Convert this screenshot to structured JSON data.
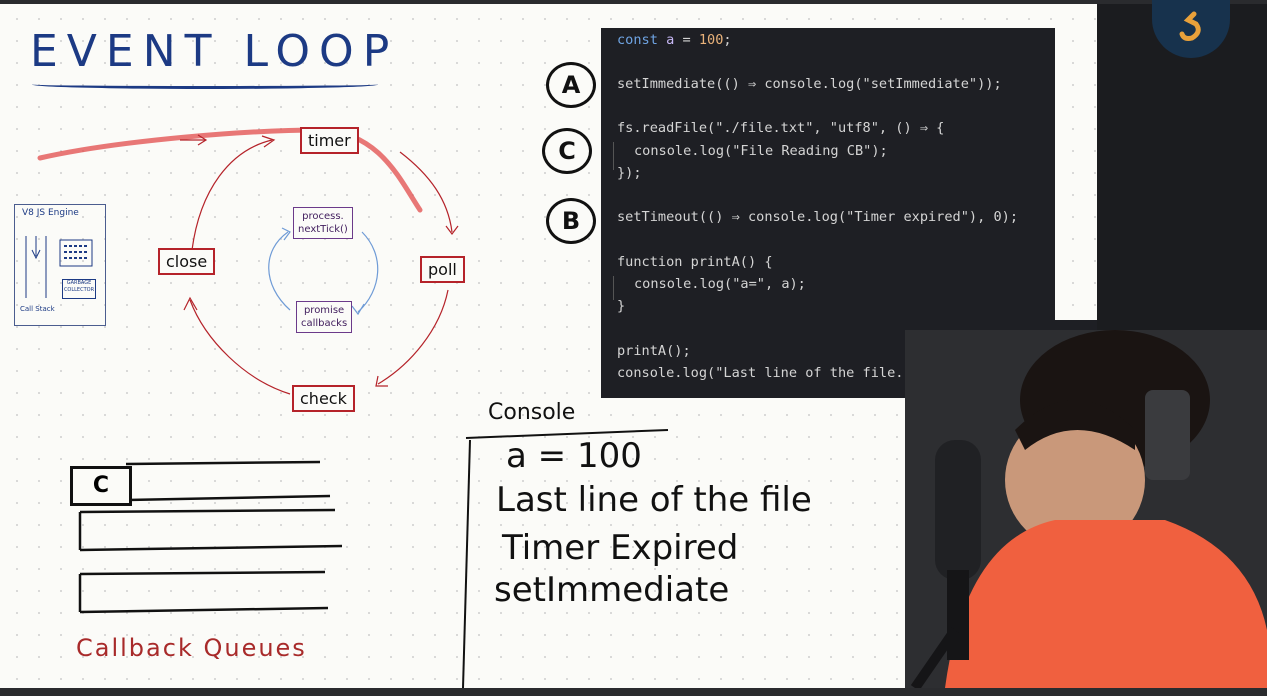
{
  "board": {
    "title": "EVENT LOOP",
    "phases": {
      "timer": "timer",
      "poll": "poll",
      "check": "check",
      "close": "close"
    },
    "microtasks": {
      "next_tick": "process.\nnextTick()",
      "promise": "promise\ncallbacks"
    },
    "v8": {
      "title": "V8 JS Engine",
      "call_stack": "Call Stack",
      "gc": "GARBAGE\nCOLLECTOR"
    },
    "queues": {
      "first_item": "C",
      "label": "Callback Queues"
    },
    "console": {
      "label": "Console",
      "lines": [
        "a = 100",
        "Last line of the file",
        "Timer Expired",
        "setImmediate"
      ]
    },
    "badges": {
      "a": "A",
      "c": "C",
      "b": "B"
    }
  },
  "code": {
    "line1": "const a = 100;",
    "line2": "setImmediate(() ⇒ console.log(\"setImmediate\"));",
    "line3": "fs.readFile(\"./file.txt\", \"utf8\", () ⇒ {",
    "line4": "console.log(\"File Reading CB\");",
    "line5": "});",
    "line6": "setTimeout(() ⇒ console.log(\"Timer expired\"), 0);",
    "line7": "function printA() {",
    "line8": "console.log(\"a=\", a);",
    "line9": "}",
    "line10": "printA();",
    "line11": "console.log(\"Last line of the file.\");"
  },
  "colors": {
    "board": "#fbfbf8",
    "title_blue": "#1c3a84",
    "phase_red": "#b5232a",
    "editor_bg": "#1e1f24",
    "presenter_shirt": "#f0603f"
  }
}
